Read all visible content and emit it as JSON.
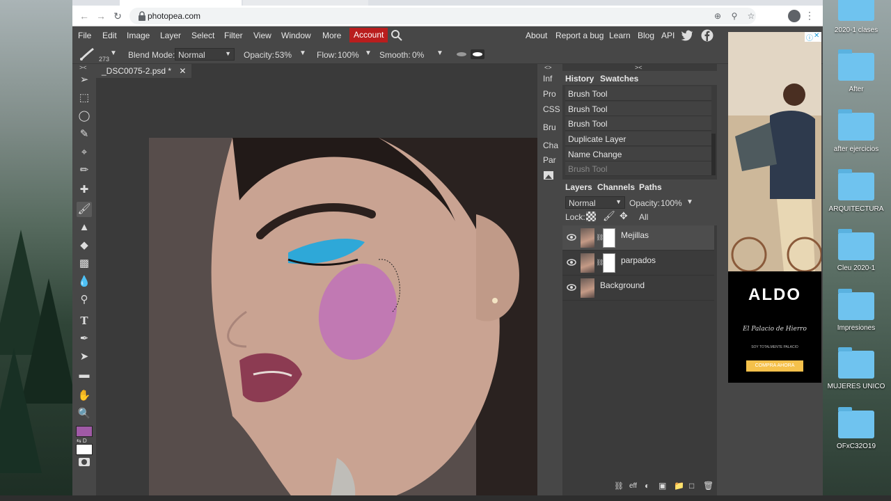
{
  "browser": {
    "url": "photopea.com"
  },
  "menubar": {
    "items": [
      "File",
      "Edit",
      "Image",
      "Layer",
      "Select",
      "Filter",
      "View",
      "Window",
      "More"
    ],
    "account": "Account",
    "right_items": [
      "About",
      "Report a bug",
      "Learn",
      "Blog",
      "API"
    ]
  },
  "options": {
    "brush_size": "273",
    "blend_mode_label": "Blend Mode:",
    "blend_mode_value": "Normal",
    "opacity_label": "Opacity:",
    "opacity_value": "53%",
    "flow_label": "Flow:",
    "flow_value": "100%",
    "smooth_label": "Smooth:",
    "smooth_value": "0%"
  },
  "document": {
    "tab_title": "_DSC0075-2.psd *"
  },
  "mini_panel": {
    "items": [
      "Inf",
      "Pro",
      "CSS",
      "Bru",
      "Cha",
      "Par"
    ]
  },
  "history": {
    "tab_history": "History",
    "tab_swatches": "Swatches",
    "rows": [
      "Brush Tool",
      "Brush Tool",
      "Brush Tool",
      "Duplicate Layer",
      "Name Change",
      "Brush Tool"
    ]
  },
  "layers": {
    "tab_layers": "Layers",
    "tab_channels": "Channels",
    "tab_paths": "Paths",
    "blend": "Normal",
    "opacity_label": "Opacity:",
    "opacity_value": "100%",
    "lock_label": "Lock:",
    "all_label": "All",
    "rows": [
      {
        "name": "Mejillas"
      },
      {
        "name": "parpados"
      },
      {
        "name": "Background"
      }
    ],
    "footer_eff": "eff"
  },
  "colors": {
    "foreground": "#a05aa6",
    "background": "#ffffff",
    "account_red": "#b91d1d"
  },
  "ad": {
    "brand": "ALDO",
    "sub": "El Palacio de Hierro",
    "tagline": "SOY TOTALMENTE PALACIO",
    "cta": "COMPRA AHORA"
  },
  "desktop": {
    "folders": [
      "2020-1 clases",
      "After",
      "after ejercicios",
      "ARQUITECTURA",
      "Cleu 2020-1",
      "Impresiones",
      "MUJERES UNICO",
      "OFxC32O19"
    ]
  }
}
